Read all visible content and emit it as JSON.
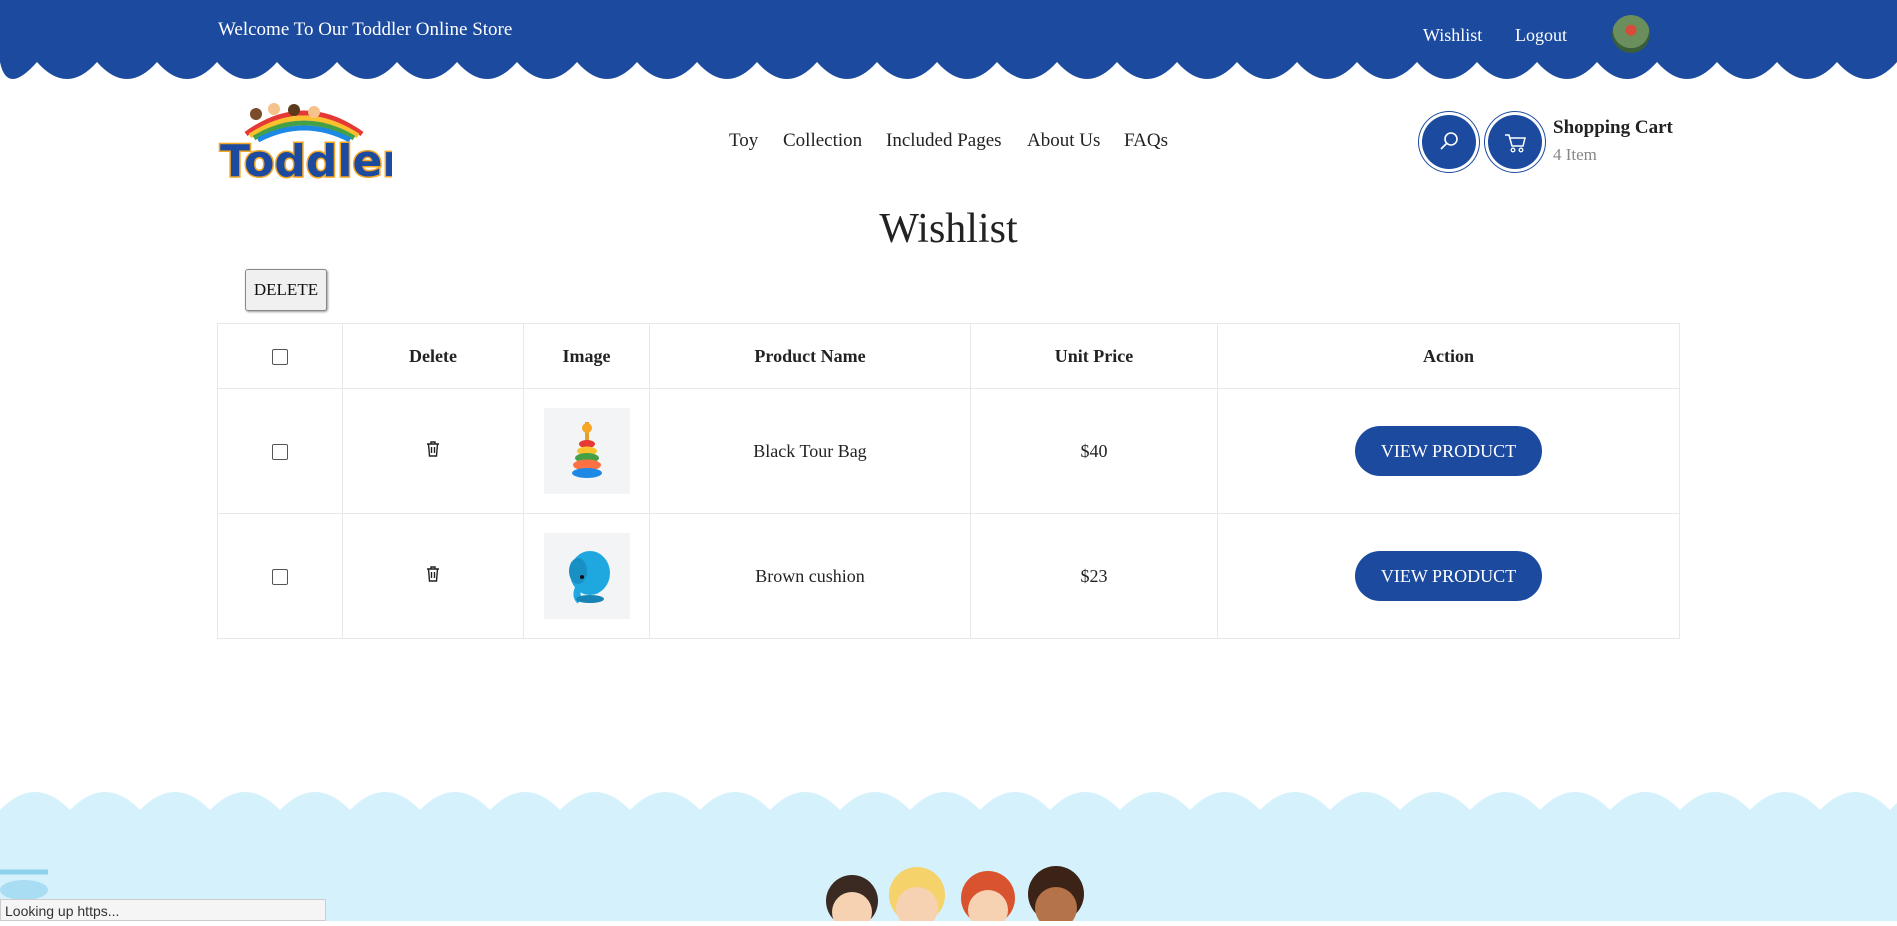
{
  "topbar": {
    "welcome": "Welcome To Our Toddler Online Store",
    "wishlist_link": "Wishlist",
    "logout_link": "Logout",
    "bg_color": "#1b4a9e"
  },
  "logo": {
    "text": "Toddler"
  },
  "nav": {
    "items": [
      "Toy",
      "Collection",
      "Included Pages",
      "About Us",
      "FAQs"
    ]
  },
  "cart": {
    "title": "Shopping Cart",
    "count": "4 Item"
  },
  "page": {
    "title": "Wishlist",
    "delete_button": "DELETE"
  },
  "table": {
    "headers": [
      "Delete",
      "Image",
      "Product Name",
      "Unit Price",
      "Action"
    ],
    "rows": [
      {
        "product": "Black Tour Bag",
        "price": "$40",
        "action": "VIEW PRODUCT",
        "image": "stacking-rings-toy"
      },
      {
        "product": "Brown cushion",
        "price": "$23",
        "action": "VIEW PRODUCT",
        "image": "blue-elephant-toy"
      }
    ]
  },
  "status_bar": {
    "text": "Looking up https..."
  },
  "colors": {
    "primary": "#1b4a9e",
    "footer": "#d5f1fc"
  }
}
